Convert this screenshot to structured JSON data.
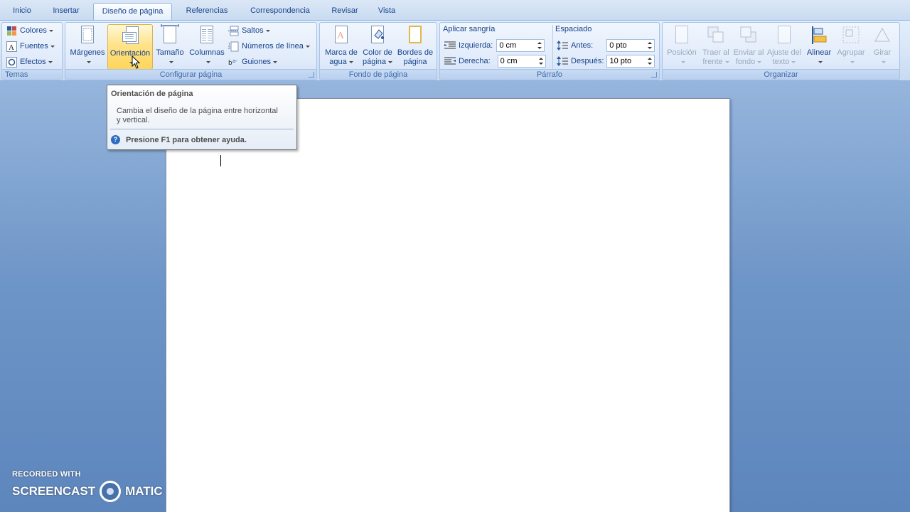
{
  "tabs": [
    {
      "label": "Inicio",
      "active": false
    },
    {
      "label": "Insertar",
      "active": false
    },
    {
      "label": "Diseño de página",
      "active": true
    },
    {
      "label": "Referencias",
      "active": false
    },
    {
      "label": "Correspondencia",
      "active": false
    },
    {
      "label": "Revisar",
      "active": false
    },
    {
      "label": "Vista",
      "active": false
    }
  ],
  "ribbon": {
    "temas": {
      "label": "Temas",
      "colores": "Colores",
      "fuentes": "Fuentes",
      "efectos": "Efectos"
    },
    "configurar": {
      "label": "Configurar página",
      "margenes": "Márgenes",
      "orientacion": "Orientación",
      "tamano": "Tamaño",
      "columnas": "Columnas",
      "saltos": "Saltos",
      "numeros_linea": "Números de línea",
      "guiones": "Guiones"
    },
    "fondo": {
      "label": "Fondo de página",
      "marca_l1": "Marca de",
      "marca_l2": "agua",
      "color_l1": "Color de",
      "color_l2": "página",
      "bordes_l1": "Bordes de",
      "bordes_l2": "página"
    },
    "parrafo": {
      "label": "Párrafo",
      "sangria_title": "Aplicar sangría",
      "izquierda_label": "Izquierda:",
      "izquierda_value": "0 cm",
      "derecha_label": "Derecha:",
      "derecha_value": "0 cm",
      "espaciado_title": "Espaciado",
      "antes_label": "Antes:",
      "antes_value": "0 pto",
      "despues_label": "Después:",
      "despues_value": "10 pto"
    },
    "organizar": {
      "label": "Organizar",
      "posicion": "Posición",
      "traer_l1": "Traer al",
      "traer_l2": "frente",
      "enviar_l1": "Enviar al",
      "enviar_l2": "fondo",
      "ajuste_l1": "Ajuste del",
      "ajuste_l2": "texto",
      "alinear": "Alinear",
      "agrupar": "Agrupar",
      "girar": "Girar"
    }
  },
  "tooltip": {
    "title": "Orientación de página",
    "body": "Cambia el diseño de la página entre horizontal y vertical.",
    "help": "Presione F1 para obtener ayuda.",
    "help_icon": "help-icon"
  },
  "watermark": {
    "line1": "RECORDED WITH",
    "line2a": "SCREENCAST",
    "line2b": "MATIC"
  },
  "colors": {
    "ribbon_text": "#15428b",
    "hover_button": "#ffd55a",
    "background": "#6e95c7"
  }
}
